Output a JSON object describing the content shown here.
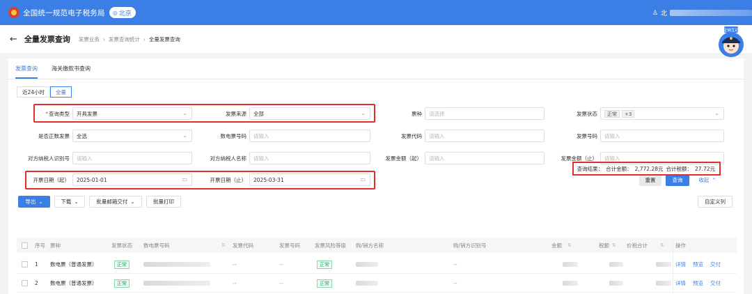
{
  "app": {
    "title": "全国统一规范电子税务局",
    "region": "北京",
    "user_prefix": "北"
  },
  "header": {
    "back_icon": "arrow-left-icon",
    "page_title": "全量发票查询",
    "breadcrumb": [
      "发票业务",
      "发票查询统计",
      "全量发票查询"
    ],
    "mascot_text": "征纳互动"
  },
  "tabs": [
    "发票查询",
    "海关缴款书查询"
  ],
  "time_range": [
    "近24小时",
    "全量"
  ],
  "filters": {
    "query_type": {
      "label": "查询类型",
      "value": "开具发票"
    },
    "invoice_source": {
      "label": "发票来源",
      "value": "全部"
    },
    "invoice_kind": {
      "label": "票种",
      "placeholder": "请选择"
    },
    "invoice_status": {
      "label": "发票状态",
      "tag": "正常",
      "more": "+3"
    },
    "is_positive": {
      "label": "是否正数发票",
      "value": "全选"
    },
    "digital_no": {
      "label": "数电票号码",
      "placeholder": "请输入"
    },
    "invoice_code": {
      "label": "发票代码",
      "placeholder": "请输入"
    },
    "invoice_no": {
      "label": "发票号码",
      "placeholder": "请输入"
    },
    "counterparty_id": {
      "label": "对方纳税人识别号",
      "placeholder": "请输入"
    },
    "counterparty_name": {
      "label": "对方纳税人名称",
      "placeholder": "请输入"
    },
    "amount_from": {
      "label": "发票金额（起）",
      "placeholder": "请输入"
    },
    "amount_to": {
      "label": "发票金额（止）",
      "placeholder": "请输入"
    },
    "date_from": {
      "label": "开票日期（起）",
      "value": "2025-01-01"
    },
    "date_to": {
      "label": "开票日期（止）",
      "value": "2025-03-31"
    }
  },
  "actions": {
    "reset": "重置",
    "query": "查询",
    "collapse": "收起"
  },
  "toolbar": {
    "export": "导出",
    "download": "下载",
    "batch_mail": "批量邮箱交付",
    "batch_print": "批量打印",
    "custom_columns": "自定义列"
  },
  "summary": {
    "label": "查询结果：",
    "total_amount_label": "合计金额：",
    "total_amount": "2,772.28元",
    "total_tax_label": "合计税额：",
    "total_tax": "27.72元"
  },
  "table": {
    "headers": [
      "序号",
      "票种",
      "发票状态",
      "数电票号码",
      "发票代码",
      "发票号码",
      "发票风险等级",
      "购/销方名称",
      "购/销方识别号",
      "金额",
      "税额",
      "价税合计",
      "操作"
    ],
    "rows": [
      {
        "index": "1",
        "kind": "数电票（普通发票）",
        "status": "正常",
        "code": "--",
        "number": "--",
        "risk": "正常",
        "tax_id": "--",
        "ops": [
          "详情",
          "预览",
          "交付"
        ]
      },
      {
        "index": "2",
        "kind": "数电票（普通发票）",
        "status": "正常",
        "code": "--",
        "number": "--",
        "risk": "正常",
        "tax_id": "--",
        "ops": [
          "详情",
          "预览",
          "交付"
        ]
      }
    ]
  },
  "colors": {
    "primary": "#3b7fe6",
    "highlight": "#e32d2d",
    "badge": "#2aa86a"
  }
}
